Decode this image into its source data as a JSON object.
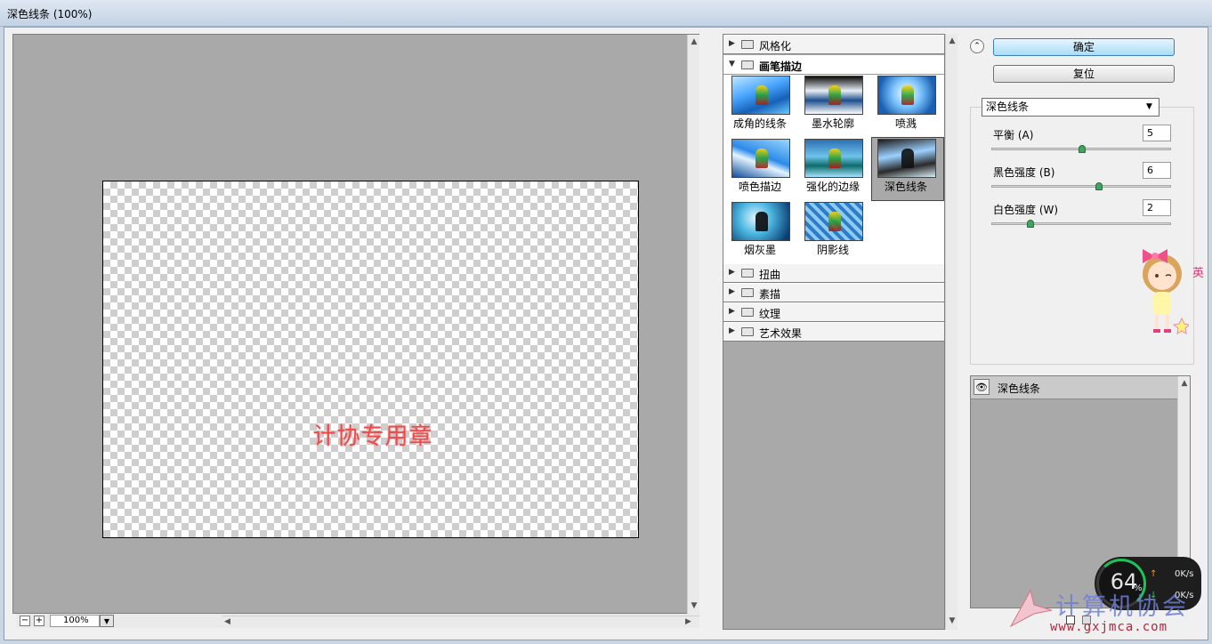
{
  "window": {
    "title": "深色线条 (100%)"
  },
  "preview": {
    "canvas_text": "计协专用章",
    "zoom": "100%",
    "zoom_minus": "−",
    "zoom_plus": "+"
  },
  "gallery": {
    "categories_top": [
      {
        "label": "风格化",
        "expanded": false
      }
    ],
    "open_category": {
      "label": "画笔描边",
      "expanded": true
    },
    "thumbnails": [
      {
        "label": "成角的线条",
        "selected": false
      },
      {
        "label": "墨水轮廓",
        "selected": false
      },
      {
        "label": "喷溅",
        "selected": false
      },
      {
        "label": "喷色描边",
        "selected": false
      },
      {
        "label": "强化的边缘",
        "selected": false
      },
      {
        "label": "深色线条",
        "selected": true
      },
      {
        "label": "烟灰墨",
        "selected": false
      },
      {
        "label": "阴影线",
        "selected": false
      }
    ],
    "categories_bottom": [
      {
        "label": "扭曲",
        "expanded": false
      },
      {
        "label": "素描",
        "expanded": false
      },
      {
        "label": "纹理",
        "expanded": false
      },
      {
        "label": "艺术效果",
        "expanded": false
      }
    ]
  },
  "panel": {
    "ok_label": "确定",
    "reset_label": "复位",
    "filter_select": "深色线条",
    "params": [
      {
        "label": "平衡 (A)",
        "value": "5",
        "level": 0.5
      },
      {
        "label": "黑色强度 (B)",
        "value": "6",
        "level": 0.6
      },
      {
        "label": "白色强度 (W)",
        "value": "2",
        "level": 0.2
      }
    ]
  },
  "layers": {
    "items": [
      {
        "label": "深色线条",
        "visible": true
      }
    ]
  },
  "overlay": {
    "meter_percent": "64",
    "meter_sign": "%",
    "up_rate": "0K/s",
    "down_rate": "0K/s",
    "mascot_text": "英",
    "watermark_text": "计算机协会",
    "watermark_url": "www.gxjmca.com"
  },
  "colors": {
    "accent_ok": "#a8dcf7",
    "preview_bg": "#a9a9a9",
    "stamp_red": "#ee4a4a",
    "slider_green": "#3ea45f"
  }
}
